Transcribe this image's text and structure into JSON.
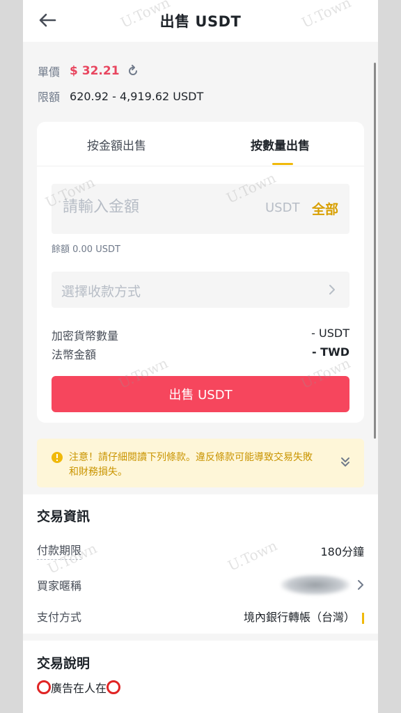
{
  "header": {
    "title": "出售 USDT"
  },
  "price": {
    "label": "單價",
    "value": "$ 32.21"
  },
  "limit": {
    "label": "限額",
    "value": "620.92 - 4,919.62 USDT"
  },
  "tabs": [
    {
      "label": "按金額出售",
      "active": false
    },
    {
      "label": "按數量出售",
      "active": true
    }
  ],
  "amount": {
    "placeholder": "請輸入金額",
    "unit": "USDT",
    "all_label": "全部"
  },
  "balance": "餘額 0.00 USDT",
  "payment_select": {
    "placeholder": "選擇收款方式"
  },
  "summary": [
    {
      "label": "加密貨幣數量",
      "value": "- USDT"
    },
    {
      "label": "法幣金額",
      "value": "- TWD"
    }
  ],
  "sell_button": "出售 USDT",
  "notice": "注意！請仔細閱讀下列條款。違反條款可能導致交易失敗和財務損失。",
  "trade_info": {
    "title": "交易資訊",
    "rows": [
      {
        "label": "付款期限",
        "value": "180分鐘"
      },
      {
        "label": "買家暱稱",
        "value": ""
      },
      {
        "label": "支付方式",
        "value": "境內銀行轉帳（台灣）"
      }
    ]
  },
  "trade_desc": {
    "title": "交易說明",
    "text": "廣告在人在"
  },
  "watermark": "U.Town",
  "colors": {
    "accent": "#f0b90b",
    "sell": "#f6465d",
    "price": "#e8455e",
    "notice_bg": "#fef6d8",
    "notice_text": "#c99400"
  }
}
